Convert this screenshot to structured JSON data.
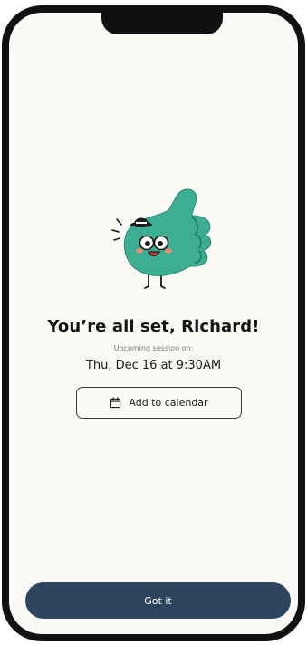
{
  "confirmation": {
    "title": "You’re all set, Richard!",
    "upcoming_label": "Upcoming session on:",
    "session_datetime": "Thu, Dec 16 at 9:30AM"
  },
  "actions": {
    "add_to_calendar_label": "Add to calendar",
    "got_it_label": "Got it"
  },
  "icons": {
    "calendar": "calendar-icon",
    "mascot": "thumbs-up-mascot-illustration"
  },
  "colors": {
    "background": "#fbf9f5",
    "primary_button": "#2e4560",
    "mascot_green": "#3dae93",
    "text": "#141414"
  }
}
